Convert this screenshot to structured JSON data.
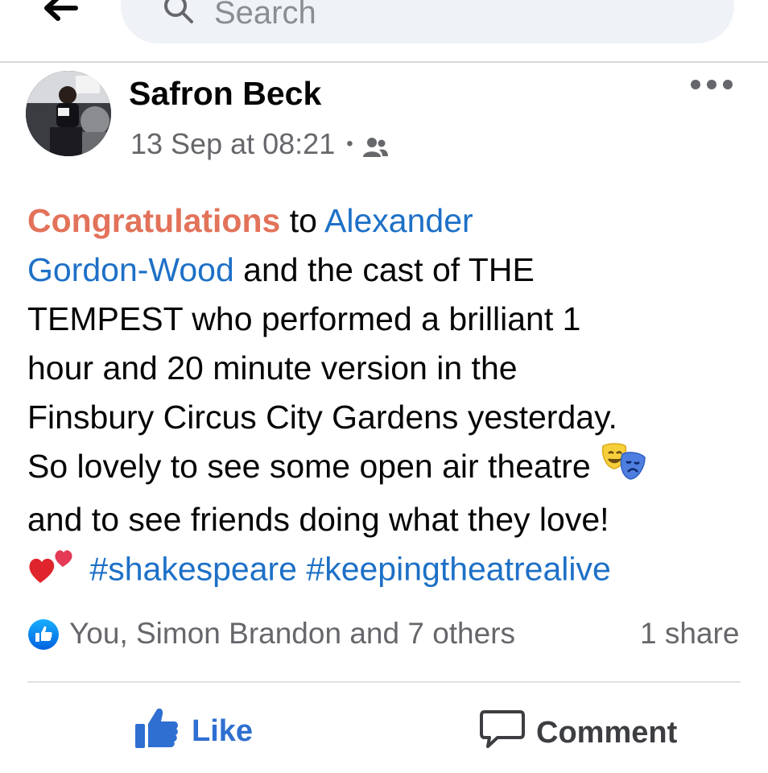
{
  "search": {
    "placeholder": "Search"
  },
  "post": {
    "author": "Safron Beck",
    "timestamp": "13 Sep at 08:21",
    "audience_icon": "friends-icon",
    "lines": [
      {
        "segments": [
          {
            "text": "Congratulations",
            "style": "orange"
          },
          {
            "text": " to ",
            "style": "plain"
          },
          {
            "text": "Alexander",
            "style": "link"
          }
        ]
      },
      {
        "segments": [
          {
            "text": "Gordon-Wood",
            "style": "link"
          },
          {
            "text": " and the cast of THE",
            "style": "plain"
          }
        ]
      },
      {
        "segments": [
          {
            "text": "TEMPEST who performed a brilliant 1",
            "style": "plain"
          }
        ]
      },
      {
        "segments": [
          {
            "text": "hour and 20 minute version in the",
            "style": "plain"
          }
        ]
      },
      {
        "segments": [
          {
            "text": "Finsbury Circus City Gardens yesterday.",
            "style": "plain"
          }
        ]
      },
      {
        "segments": [
          {
            "text": "So lovely to see some open air theatre ",
            "style": "plain"
          },
          {
            "emoji": "performing-arts-emoji"
          }
        ]
      },
      {
        "segments": [
          {
            "text": "and to see friends doing what they love!",
            "style": "plain"
          }
        ]
      },
      {
        "segments": [
          {
            "emoji": "two-hearts-emoji"
          },
          {
            "text": " ",
            "style": "plain"
          },
          {
            "text": "#shakespeare",
            "style": "link"
          },
          {
            "text": " ",
            "style": "plain"
          },
          {
            "text": "#keepingtheatrealive",
            "style": "link"
          }
        ]
      }
    ]
  },
  "reactions": {
    "text": "You, Simon Brandon and 7 others",
    "shares": "1 share"
  },
  "actions": {
    "like": "Like",
    "comment": "Comment"
  },
  "colors": {
    "link": "#1d70c7",
    "highlight": "#e2735a",
    "like": "#2f6fd1",
    "meta": "#65676b"
  }
}
